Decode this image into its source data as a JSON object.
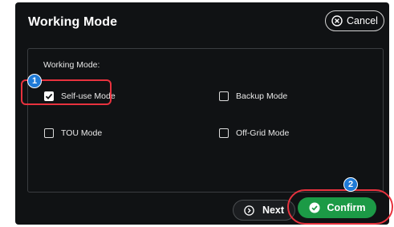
{
  "dialog": {
    "title": "Working Mode",
    "cancel_label": "Cancel",
    "section_label": "Working Mode:",
    "options": [
      {
        "label": "Self-use Mode",
        "checked": true
      },
      {
        "label": "Backup Mode",
        "checked": false
      },
      {
        "label": "TOU Mode",
        "checked": false
      },
      {
        "label": "Off-Grid Mode",
        "checked": false
      }
    ],
    "next_label": "Next",
    "confirm_label": "Confirm"
  },
  "markers": [
    "1",
    "2"
  ],
  "icons": {
    "cancel": "close-circle-icon",
    "next": "chevron-right-circle-icon",
    "confirm": "check-circle-icon",
    "checkbox_checked": "checkmark-icon"
  },
  "colors": {
    "background": "#101214",
    "confirm_green": "#1c9a46",
    "highlight_red": "#e8323e",
    "marker_blue": "#1f7ad6"
  }
}
